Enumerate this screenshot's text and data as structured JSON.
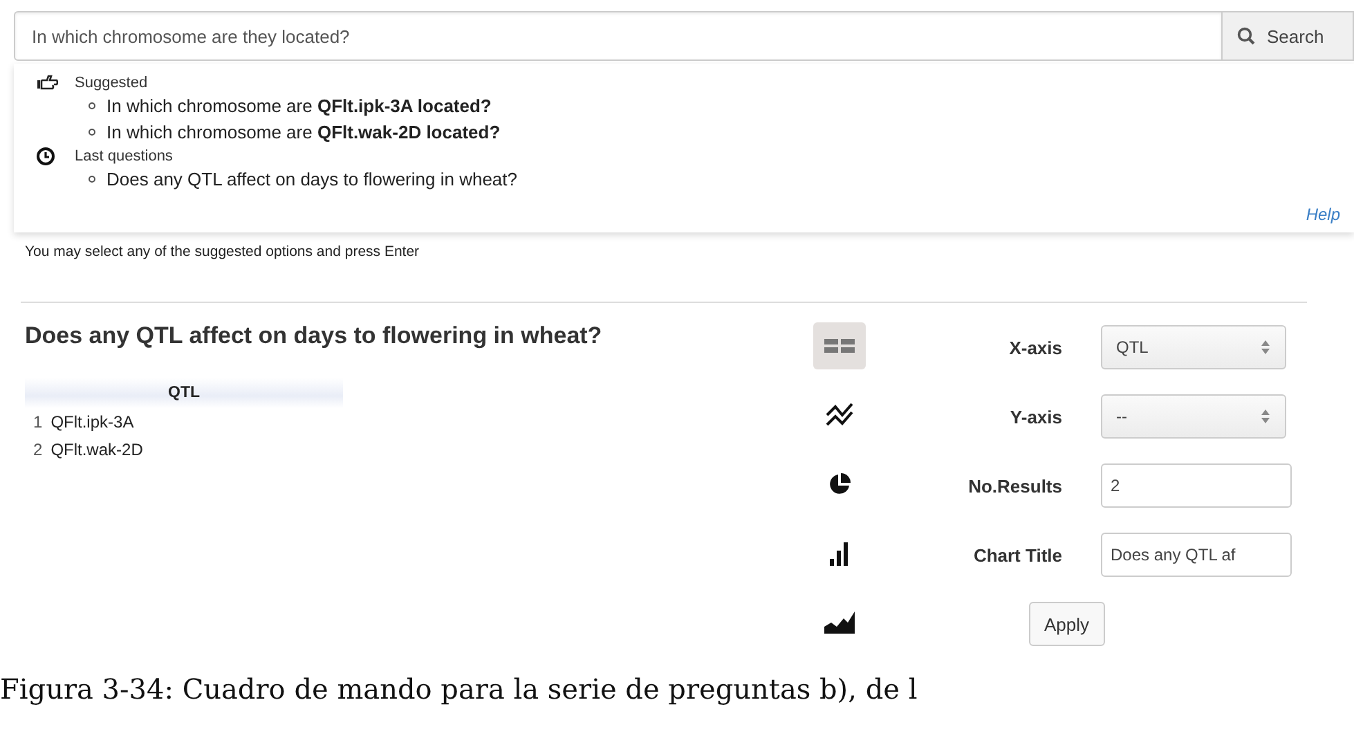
{
  "search": {
    "value": "In which chromosome are they located?",
    "button": "Search"
  },
  "suggestions_panel": {
    "sections": [
      {
        "kind": "suggested",
        "label": "Suggested",
        "items": [
          "In which chromosome are **QFlt.ipk-3A located?**",
          "In which chromosome are **QFlt.wak-2D located?**"
        ]
      },
      {
        "kind": "history",
        "label": "Last questions",
        "items": [
          "Does any QTL affect on days to flowering in wheat?"
        ]
      }
    ],
    "help_link": "Help"
  },
  "hint": "You may select any of the suggested options and press Enter",
  "result": {
    "title": "Does any QTL affect on days to flowering in wheat?",
    "table": {
      "columns": [
        "QTL"
      ],
      "rows": [
        {
          "index": "1",
          "cells": [
            "QFlt.ipk-3A"
          ]
        },
        {
          "index": "2",
          "cells": [
            "QFlt.wak-2D"
          ]
        }
      ]
    }
  },
  "chart_types": [
    {
      "kind": "table",
      "selected": true
    },
    {
      "kind": "line",
      "selected": false
    },
    {
      "kind": "pie",
      "selected": false
    },
    {
      "kind": "bar",
      "selected": false
    },
    {
      "kind": "area",
      "selected": false
    }
  ],
  "settings": [
    {
      "kind": "select",
      "label": "X-axis",
      "value": "QTL"
    },
    {
      "kind": "select",
      "label": "Y-axis",
      "value": "--"
    },
    {
      "kind": "input",
      "label": "No.Results",
      "value": "2"
    },
    {
      "kind": "input",
      "label": "Chart Title",
      "value": "Does any QTL af"
    }
  ],
  "apply_button": "Apply",
  "caption": "Figura 3-34: Cuadro de mando para la serie de preguntas b), de l"
}
